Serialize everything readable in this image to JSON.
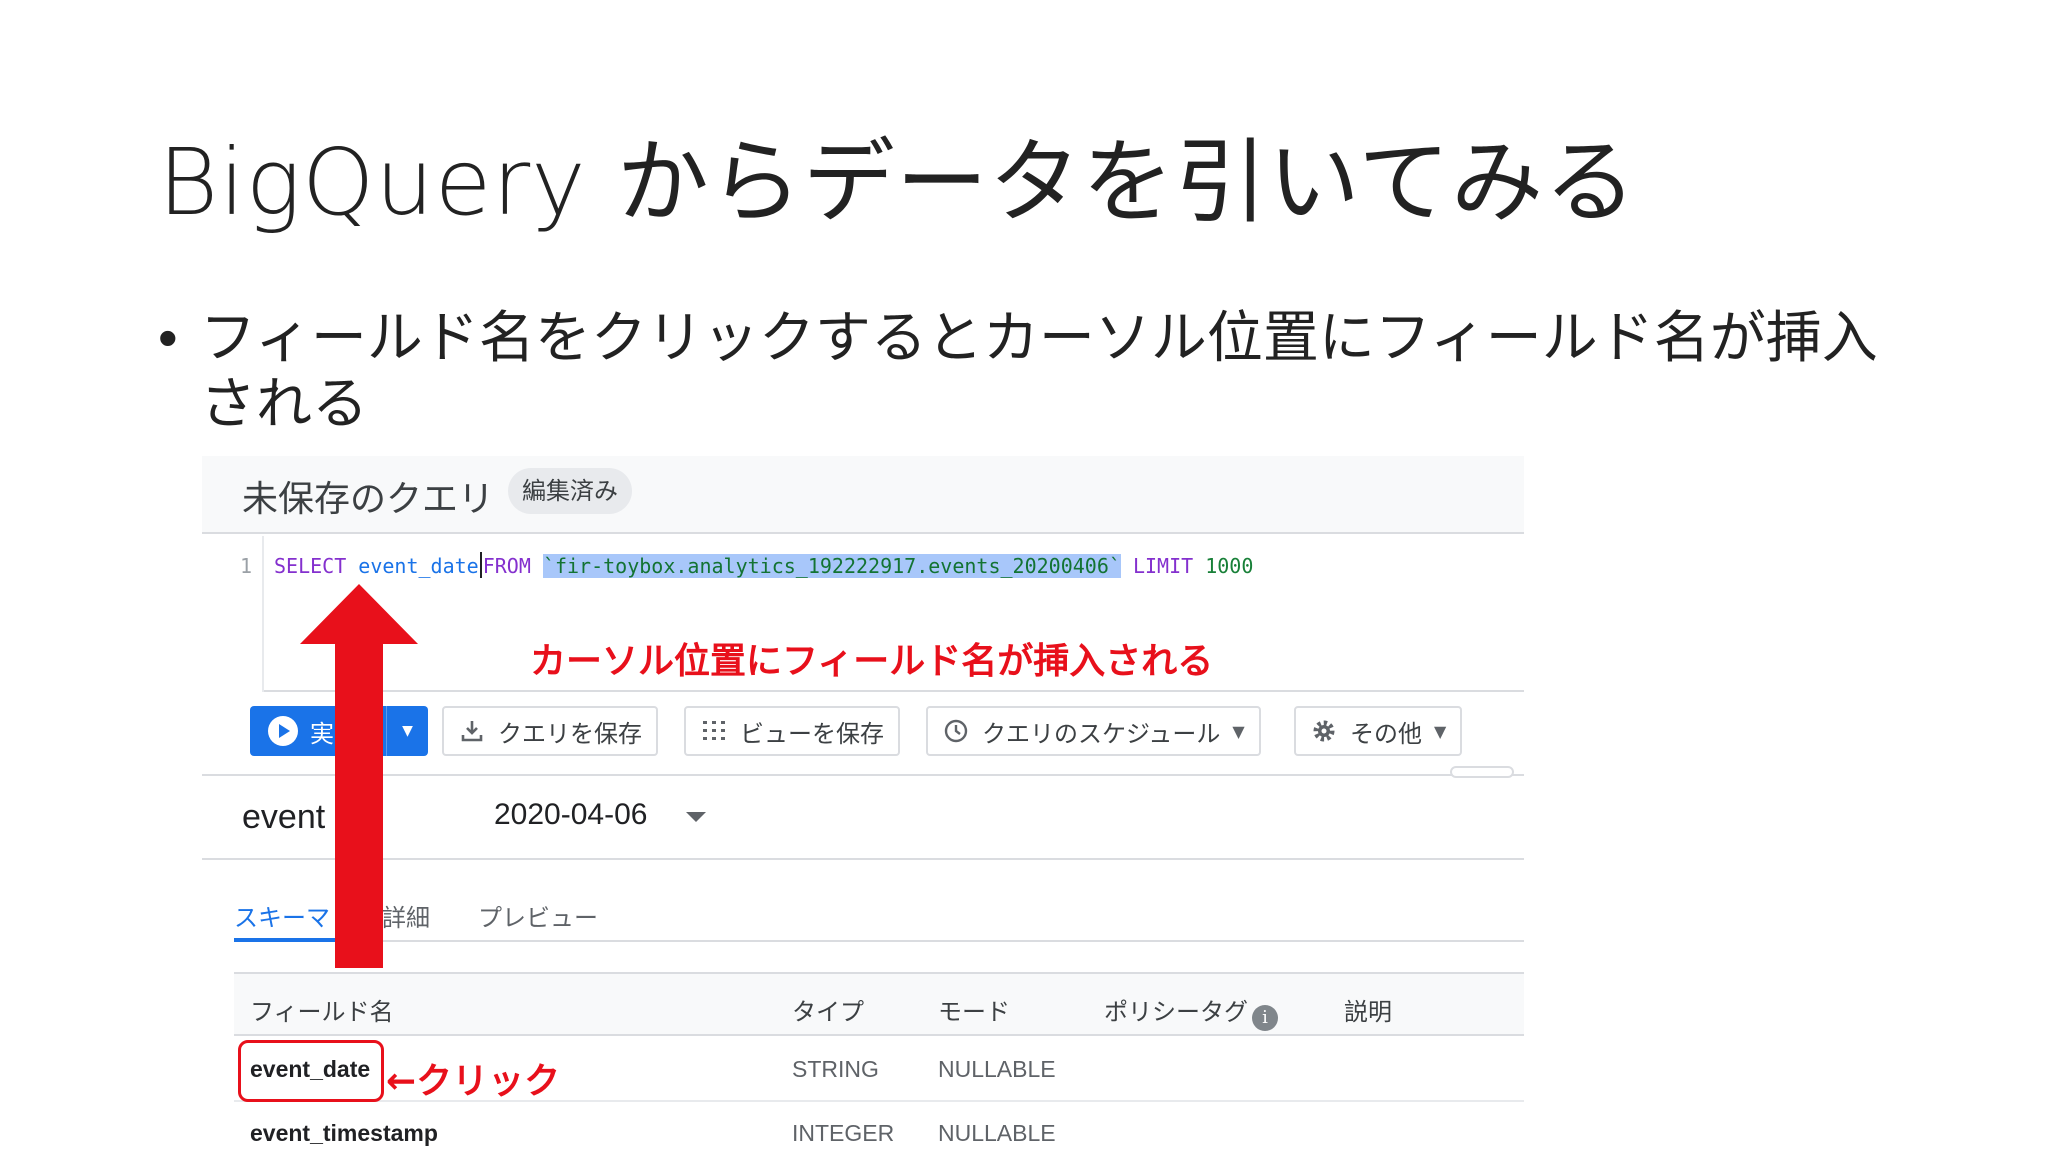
{
  "slide": {
    "title": "BigQuery からデータを引いてみる",
    "bullet_dot": "•",
    "bullet": "フィールド名をクリックするとカーソル位置にフィールド名が挿入される"
  },
  "query": {
    "title": "未保存のクエリ",
    "badge": "編集済み",
    "line_number": "1",
    "code": {
      "select": "SELECT",
      "field": "event_date",
      "from": "FROM",
      "table": "`fir-toybox.analytics_192222917.events_20200406`",
      "limit": "LIMIT",
      "limit_value": "1000"
    }
  },
  "annotations": {
    "insert_note": "カーソル位置にフィールド名が挿入される",
    "click_note": "←クリック",
    "colors": {
      "red": "#e8101b"
    }
  },
  "toolbar": {
    "run_label": "実",
    "save_query": "クエリを保存",
    "save_view": "ビューを保存",
    "schedule": "クエリのスケジュール",
    "more": "その他"
  },
  "table": {
    "name": "event",
    "date": "2020-04-06"
  },
  "tabs": [
    "スキーマ",
    "詳細",
    "プレビュー"
  ],
  "schema": {
    "headers": {
      "field": "フィールド名",
      "type": "タイプ",
      "mode": "モード",
      "policy_tag": "ポリシータグ",
      "info": "i",
      "description": "説明"
    },
    "rows": [
      {
        "name": "event_date",
        "type": "STRING",
        "mode": "NULLABLE"
      },
      {
        "name": "event_timestamp",
        "type": "INTEGER",
        "mode": "NULLABLE"
      }
    ]
  },
  "colors": {
    "accent": "#1a73e8",
    "annotation_red": "#e8101b",
    "selection": "#a8c7fa"
  }
}
